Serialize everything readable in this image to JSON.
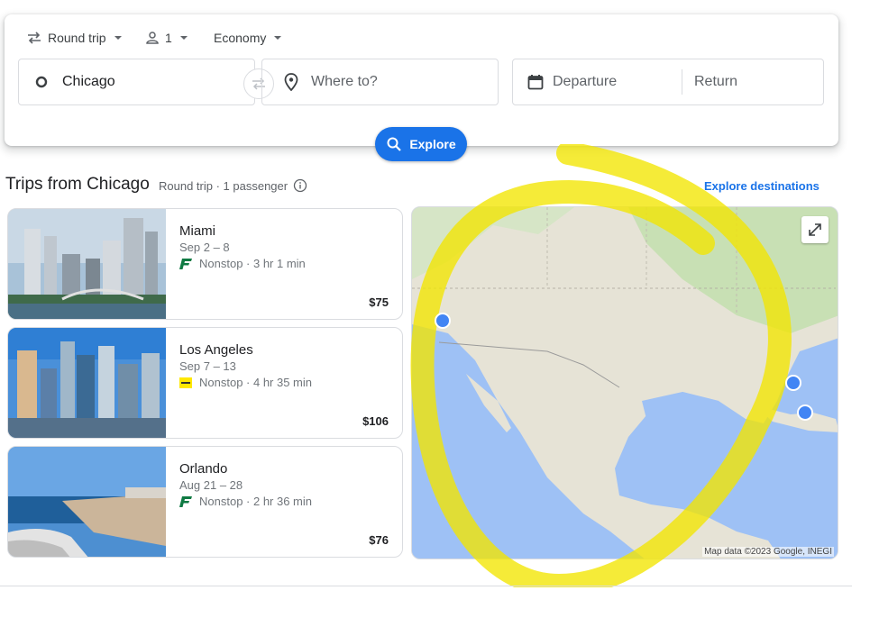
{
  "search": {
    "trip_type": "Round trip",
    "passengers": "1",
    "cabin_class": "Economy",
    "origin": "Chicago",
    "destination_placeholder": "Where to?",
    "departure_placeholder": "Departure",
    "return_placeholder": "Return",
    "explore_label": "Explore"
  },
  "section": {
    "title": "Trips from Chicago",
    "subtitle": "Round trip · 1 passenger",
    "explore_destinations_label": "Explore destinations"
  },
  "trips": [
    {
      "city": "Miami",
      "dates": "Sep 2 – 8",
      "stops": "Nonstop · 3 hr 1 min",
      "price": "$75",
      "airline_icon": "frontier-logo"
    },
    {
      "city": "Los Angeles",
      "dates": "Sep 7 – 13",
      "stops": "Nonstop · 4 hr 35 min",
      "price": "$106",
      "airline_icon": "spirit-logo"
    },
    {
      "city": "Orlando",
      "dates": "Aug 21 – 28",
      "stops": "Nonstop · 2 hr 36 min",
      "price": "$76",
      "airline_icon": "frontier-logo"
    }
  ],
  "map": {
    "credit": "Map data ©2023 Google, INEGI"
  },
  "colors": {
    "accent": "#1a73e8",
    "highlight": "#f2e600",
    "frontier": "#0f7a43",
    "spirit": "#ffe800"
  }
}
